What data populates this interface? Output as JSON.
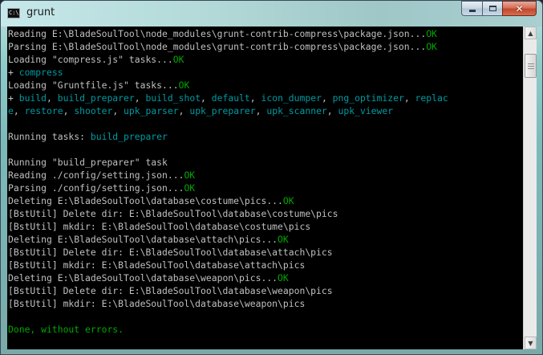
{
  "window": {
    "title": "grunt",
    "app_icon_text": "C:\\.",
    "controls": {
      "minimize": "minimize",
      "maximize": "maximize",
      "close": "close"
    }
  },
  "colors": {
    "default": "#c0c0c0",
    "teal": "#009aa0",
    "green": "#00a800"
  },
  "console": {
    "lines": [
      [
        {
          "t": "Reading E:\\BladeSoulTool\\node_modules\\grunt-contrib-compress\\package.json...",
          "c": "gray"
        },
        {
          "t": "OK",
          "c": "green"
        }
      ],
      [
        {
          "t": "Parsing E:\\BladeSoulTool\\node_modules\\grunt-contrib-compress\\package.json...",
          "c": "gray"
        },
        {
          "t": "OK",
          "c": "green"
        }
      ],
      [
        {
          "t": "Loading \"compress.js\" tasks...",
          "c": "gray"
        },
        {
          "t": "OK",
          "c": "green"
        }
      ],
      [
        {
          "t": "+ ",
          "c": "gray"
        },
        {
          "t": "compress",
          "c": "teal"
        }
      ],
      [
        {
          "t": "Loading \"Gruntfile.js\" tasks...",
          "c": "gray"
        },
        {
          "t": "OK",
          "c": "green"
        }
      ],
      [
        {
          "t": "+ ",
          "c": "gray"
        },
        {
          "t": "build",
          "c": "teal"
        },
        {
          "t": ", ",
          "c": "gray"
        },
        {
          "t": "build_preparer",
          "c": "teal"
        },
        {
          "t": ", ",
          "c": "gray"
        },
        {
          "t": "build_shot",
          "c": "teal"
        },
        {
          "t": ", ",
          "c": "gray"
        },
        {
          "t": "default",
          "c": "teal"
        },
        {
          "t": ", ",
          "c": "gray"
        },
        {
          "t": "icon_dumper",
          "c": "teal"
        },
        {
          "t": ", ",
          "c": "gray"
        },
        {
          "t": "png_optimizer",
          "c": "teal"
        },
        {
          "t": ", ",
          "c": "gray"
        },
        {
          "t": "replac",
          "c": "teal"
        }
      ],
      [
        {
          "t": "e",
          "c": "teal"
        },
        {
          "t": ", ",
          "c": "gray"
        },
        {
          "t": "restore",
          "c": "teal"
        },
        {
          "t": ", ",
          "c": "gray"
        },
        {
          "t": "shooter",
          "c": "teal"
        },
        {
          "t": ", ",
          "c": "gray"
        },
        {
          "t": "upk_parser",
          "c": "teal"
        },
        {
          "t": ", ",
          "c": "gray"
        },
        {
          "t": "upk_preparer",
          "c": "teal"
        },
        {
          "t": ", ",
          "c": "gray"
        },
        {
          "t": "upk_scanner",
          "c": "teal"
        },
        {
          "t": ", ",
          "c": "gray"
        },
        {
          "t": "upk_viewer",
          "c": "teal"
        }
      ],
      [],
      [
        {
          "t": "Running tasks: ",
          "c": "gray"
        },
        {
          "t": "build_preparer",
          "c": "teal"
        }
      ],
      [],
      [
        {
          "t": "Running \"build_preparer\" task",
          "c": "gray"
        }
      ],
      [
        {
          "t": "Reading ./config/setting.json...",
          "c": "gray"
        },
        {
          "t": "OK",
          "c": "green"
        }
      ],
      [
        {
          "t": "Parsing ./config/setting.json...",
          "c": "gray"
        },
        {
          "t": "OK",
          "c": "green"
        }
      ],
      [
        {
          "t": "Deleting E:\\BladeSoulTool\\database\\costume\\pics...",
          "c": "gray"
        },
        {
          "t": "OK",
          "c": "green"
        }
      ],
      [
        {
          "t": "[BstUtil] Delete dir: E:\\BladeSoulTool\\database\\costume\\pics",
          "c": "gray"
        }
      ],
      [
        {
          "t": "[BstUtil] mkdir: E:\\BladeSoulTool\\database\\costume\\pics",
          "c": "gray"
        }
      ],
      [
        {
          "t": "Deleting E:\\BladeSoulTool\\database\\attach\\pics...",
          "c": "gray"
        },
        {
          "t": "OK",
          "c": "green"
        }
      ],
      [
        {
          "t": "[BstUtil] Delete dir: E:\\BladeSoulTool\\database\\attach\\pics",
          "c": "gray"
        }
      ],
      [
        {
          "t": "[BstUtil] mkdir: E:\\BladeSoulTool\\database\\attach\\pics",
          "c": "gray"
        }
      ],
      [
        {
          "t": "Deleting E:\\BladeSoulTool\\database\\weapon\\pics...",
          "c": "gray"
        },
        {
          "t": "OK",
          "c": "green"
        }
      ],
      [
        {
          "t": "[BstUtil] Delete dir: E:\\BladeSoulTool\\database\\weapon\\pics",
          "c": "gray"
        }
      ],
      [
        {
          "t": "[BstUtil] mkdir: E:\\BladeSoulTool\\database\\weapon\\pics",
          "c": "gray"
        }
      ],
      [],
      [
        {
          "t": "Done, without errors.",
          "c": "green"
        }
      ]
    ]
  },
  "scrollbar": {
    "up_icon": "arrow-up-icon",
    "down_icon": "arrow-down-icon",
    "up_glyph": "▲",
    "down_glyph": "▼"
  }
}
